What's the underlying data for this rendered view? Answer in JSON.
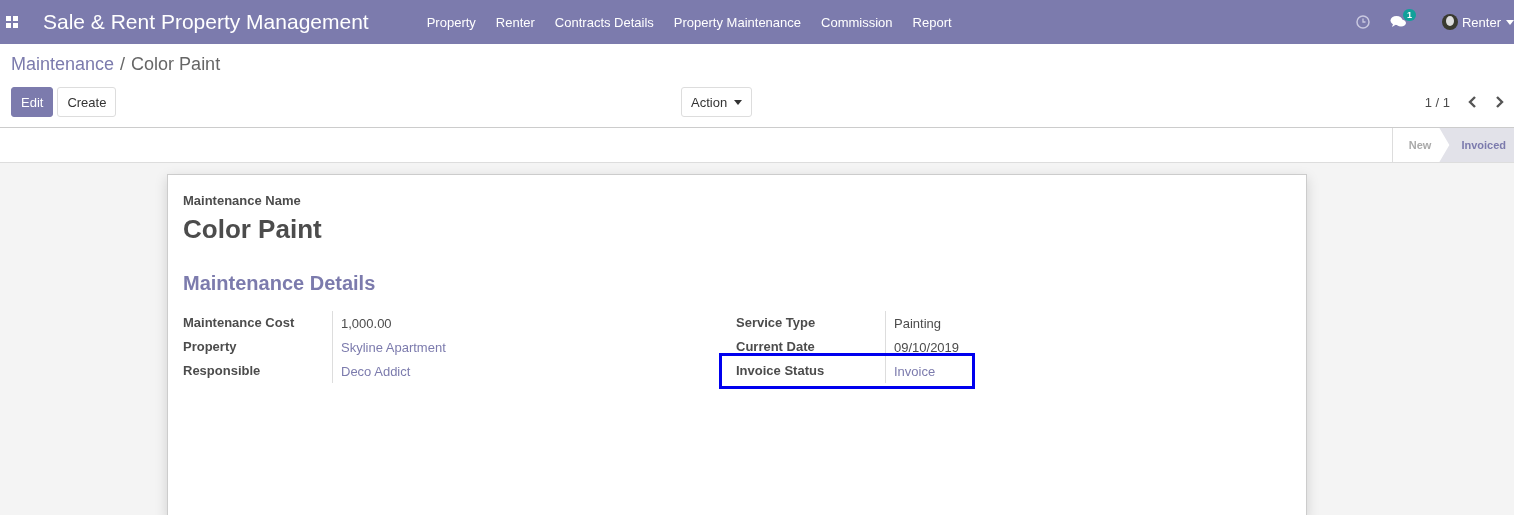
{
  "navbar": {
    "app_title": "Sale & Rent Property Management",
    "menu": [
      "Property",
      "Renter",
      "Contracts Details",
      "Property Maintenance",
      "Commission",
      "Report"
    ],
    "messages_badge": "1",
    "user": "Renter"
  },
  "breadcrumb": [
    "Maintenance",
    "/",
    "Color Paint"
  ],
  "buttons": {
    "edit": "Edit",
    "create": "Create",
    "action": "Action"
  },
  "pager": "1 / 1",
  "statusbar": [
    {
      "label": "New",
      "selected": false
    },
    {
      "label": "Invoiced",
      "selected": true
    }
  ],
  "form": {
    "name_label": "Maintenance Name",
    "name": "Color Paint",
    "section_title": "Maintenance Details",
    "left_fields": [
      {
        "label": "Maintenance Cost",
        "value": "1,000.00",
        "kind": "text",
        "highlighted": false
      },
      {
        "label": "Property",
        "value": "Skyline Apartment",
        "kind": "link",
        "highlighted": false
      },
      {
        "label": "Responsible",
        "value": "Deco Addict",
        "kind": "link",
        "highlighted": false
      }
    ],
    "right_fields": [
      {
        "label": "Service Type",
        "value": "Painting",
        "kind": "text",
        "highlighted": false
      },
      {
        "label": "Current Date",
        "value": "09/10/2019",
        "kind": "text",
        "highlighted": false
      },
      {
        "label": "Invoice Status",
        "value": "Invoice",
        "kind": "link",
        "highlighted": true
      }
    ]
  }
}
